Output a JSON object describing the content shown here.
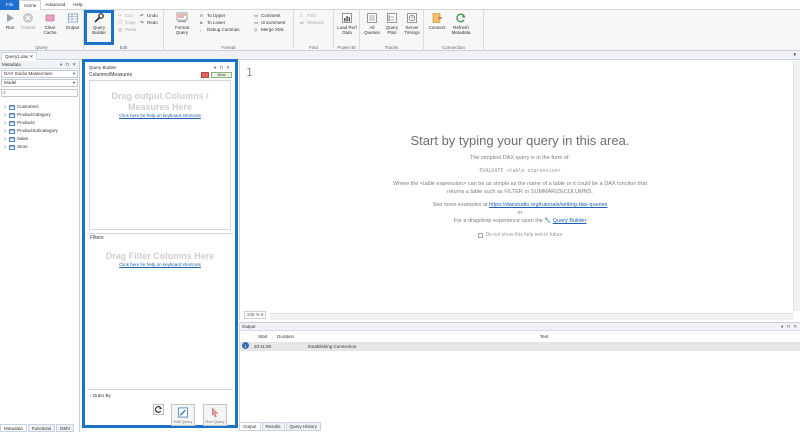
{
  "ribbon_tabs": [
    "File",
    "Home",
    "Advanced",
    "Help"
  ],
  "ribbon": {
    "run": "Run",
    "cancel": "Cancel",
    "clear_cache": "Clear Cache",
    "output": "Output",
    "query_builder": "Query Builder",
    "cut": "Cut",
    "copy": "Copy",
    "paste": "Paste",
    "undo": "Undo",
    "redo": "Redo",
    "format_query": "Format Query",
    "to_upper": "To Upper",
    "to_lower": "To Lower",
    "debug_commas": "Debug Commas",
    "comment": "Comment",
    "uncomment": "Uncomment",
    "merge_xml": "Merge XML",
    "find": "Find",
    "replace": "Replace",
    "load_perf_data": "Load Perf Data",
    "all_queries": "All Queries",
    "query_plan": "Query Plan",
    "server_timings": "Server Timings",
    "connect": "Connect",
    "refresh_metadata": "Refresh Metadata",
    "groups": {
      "query": "Query",
      "edit": "Edit",
      "format": "Format",
      "find": "Find",
      "power_bi": "Power BI",
      "traces": "Traces",
      "connection": "Connection"
    }
  },
  "doc_tab": "Query1.dax",
  "metadata": {
    "title": "Metadata",
    "model_combo": "DAX Studio Masterclass",
    "perspective_combo": "Model",
    "tables": [
      "Customers",
      "ProductCategory",
      "Products",
      "ProductSubcategory",
      "Sales",
      "Store"
    ],
    "bottom_tabs": [
      "Metadata",
      "Functions",
      "DMV"
    ]
  },
  "query_builder": {
    "title": "Query Builder",
    "columns_label": "Columns/Measures",
    "new_label": "New",
    "drop_columns": "Drag output Columns / Measures Here",
    "help_link": "Click here for help on keyboard shortcuts",
    "filters_label": "Filters",
    "drop_filters": "Drag Filter Columns Here",
    "order_by": "Order By",
    "edit_query": "Edit Query",
    "run_query": "Run Query"
  },
  "editor": {
    "line_number": "1",
    "zoom": "238 %",
    "help_title": "Start by typing your query in this area.",
    "help_simplest": "The simplest DAX query is in the form of:",
    "help_code": "EVALUATE <table expression>",
    "help_where": "Where the <table expression> can be as simple as the name of a table or it could be a DAX function that returns a table such as FILTER or SUMMARIZECOLUMNS.",
    "help_more": "See more examples at",
    "help_url": "https://daxstudio.org/tutorials/writing-dax-queries",
    "help_or": "or",
    "help_drag": "For a drag/drop experience open the",
    "help_qb": "Query Builder",
    "help_checkbox": "Do not show this help text in future"
  },
  "output": {
    "title": "Output",
    "columns": [
      "Start",
      "Duration",
      "Text"
    ],
    "rows": [
      {
        "start": "20:11:50",
        "duration": "",
        "text": "Establishing Connection"
      }
    ],
    "tabs": [
      "Output",
      "Results",
      "Query History"
    ]
  },
  "colors": {
    "accent": "#1a73c8",
    "file_tab": "#1e6fd1",
    "link": "#1a5fb4"
  }
}
